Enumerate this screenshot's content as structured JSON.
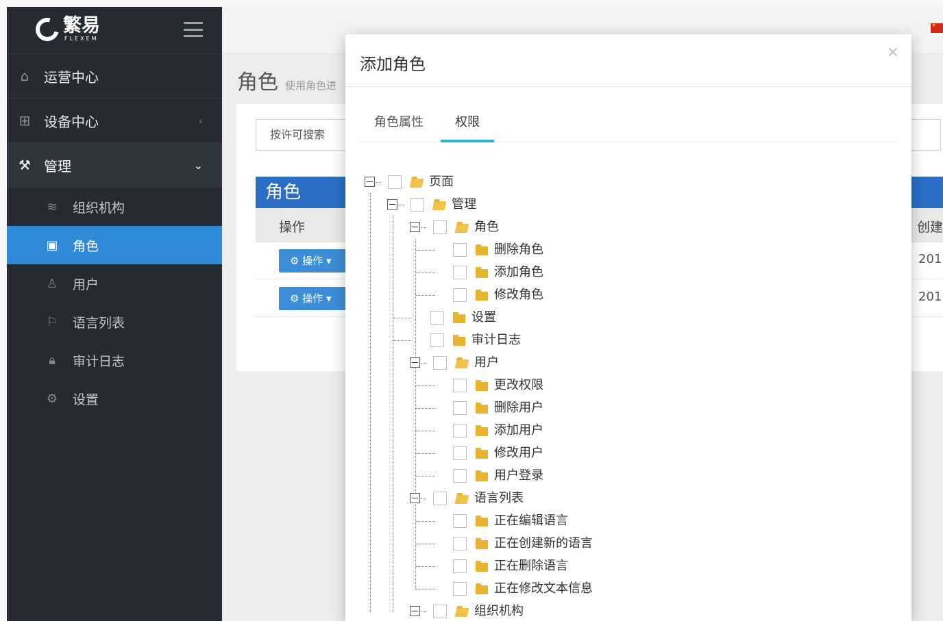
{
  "brand": {
    "name_cn": "繁易",
    "name_en": "FLEXEM"
  },
  "sidebar": {
    "items": [
      {
        "label": "运营中心",
        "icon": "home-icon"
      },
      {
        "label": "设备中心",
        "icon": "grid-icon",
        "chevron": "‹"
      },
      {
        "label": "管理",
        "icon": "wrench-icon",
        "chevron": "⌄"
      }
    ],
    "sub_items": [
      {
        "label": "组织机构",
        "icon": "layers-icon"
      },
      {
        "label": "角色",
        "icon": "briefcase-icon"
      },
      {
        "label": "用户",
        "icon": "user-icon"
      },
      {
        "label": "语言列表",
        "icon": "flag-icon"
      },
      {
        "label": "审计日志",
        "icon": "lock-icon"
      },
      {
        "label": "设置",
        "icon": "gear-icon"
      }
    ]
  },
  "page": {
    "title": "角色",
    "subtitle": "使用角色进",
    "search_placeholder": "按许可搜索",
    "panel_title": "角色",
    "col_action": "操作",
    "col_created": "创建",
    "rows": [
      {
        "action": "操作",
        "date": "201"
      },
      {
        "action": "操作",
        "date": "201"
      }
    ]
  },
  "modal": {
    "title": "添加角色",
    "close": "×",
    "tabs": [
      "角色属性",
      "权限"
    ],
    "active_tab": 1,
    "tree": [
      {
        "label": "页面",
        "depth": 0,
        "open": true,
        "toggle": true
      },
      {
        "label": "管理",
        "depth": 1,
        "open": true,
        "toggle": true
      },
      {
        "label": "角色",
        "depth": 2,
        "open": true,
        "toggle": true
      },
      {
        "label": "删除角色",
        "depth": 3
      },
      {
        "label": "添加角色",
        "depth": 3
      },
      {
        "label": "修改角色",
        "depth": 3
      },
      {
        "label": "设置",
        "depth": 2
      },
      {
        "label": "审计日志",
        "depth": 2
      },
      {
        "label": "用户",
        "depth": 2,
        "open": true,
        "toggle": true
      },
      {
        "label": "更改权限",
        "depth": 3
      },
      {
        "label": "删除用户",
        "depth": 3
      },
      {
        "label": "添加用户",
        "depth": 3
      },
      {
        "label": "修改用户",
        "depth": 3
      },
      {
        "label": "用户登录",
        "depth": 3
      },
      {
        "label": "语言列表",
        "depth": 2,
        "open": true,
        "toggle": true
      },
      {
        "label": "正在编辑语言",
        "depth": 3
      },
      {
        "label": "正在创建新的语言",
        "depth": 3
      },
      {
        "label": "正在删除语言",
        "depth": 3
      },
      {
        "label": "正在修改文本信息",
        "depth": 3
      },
      {
        "label": "组织机构",
        "depth": 2,
        "open": true,
        "toggle": true
      }
    ]
  },
  "colors": {
    "sidebar": "#262b33",
    "active": "#2f8bd8",
    "header_blue": "#2a6fc4",
    "tab_accent": "#2bb4d0",
    "folder": "#e8b32f"
  }
}
